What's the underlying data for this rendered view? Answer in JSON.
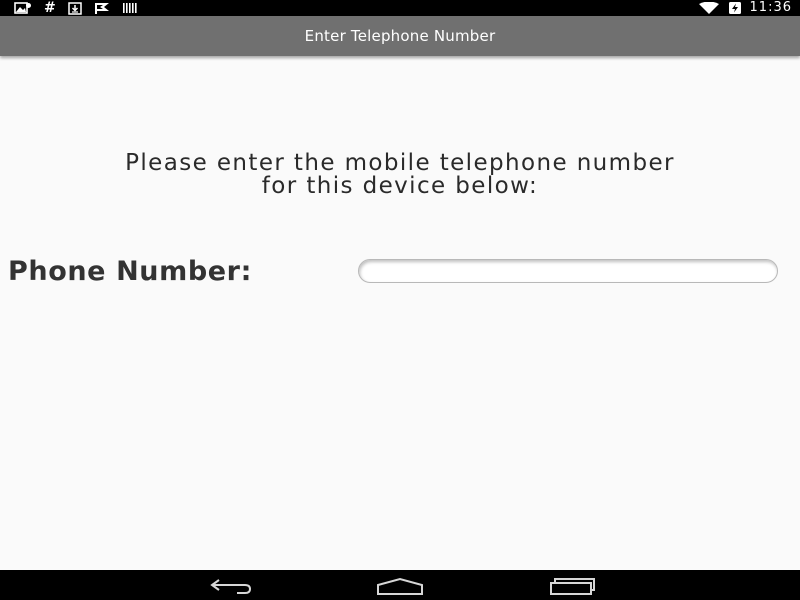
{
  "status_bar": {
    "time": "11:36",
    "left_icons": [
      "gallery-notification-icon",
      "hash-notification-icon",
      "download-icon",
      "flag-notification-icon",
      "barcode-icon"
    ],
    "hash_symbol": "#",
    "right_icons": [
      "wifi-icon",
      "battery-charging-icon"
    ]
  },
  "action_bar": {
    "title": "Enter Telephone Number"
  },
  "content": {
    "instruction_line1": "Please enter the mobile telephone number",
    "instruction_line2": "for this device below:",
    "phone_label": "Phone Number:",
    "phone_input": {
      "value": "",
      "placeholder": ""
    }
  },
  "nav_bar": {
    "buttons": [
      "back-button",
      "home-button",
      "recent-apps-button"
    ]
  },
  "colors": {
    "action_bar_bg": "#707070",
    "background": "#fafafa",
    "system_bar": "#000000"
  }
}
